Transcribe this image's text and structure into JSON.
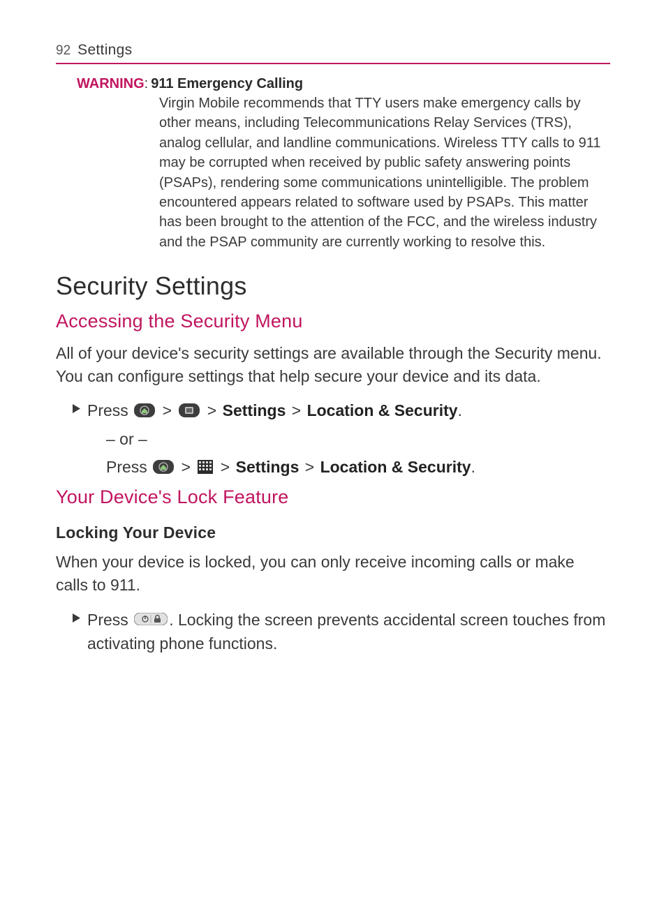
{
  "header": {
    "page_number": "92",
    "title": "Settings"
  },
  "warning": {
    "label": "WARNING",
    "colon": ": ",
    "subject": "911 Emergency Calling",
    "body": "Virgin Mobile recommends that TTY users make emergency calls by other means, including Telecommunications Relay Services (TRS), analog cellular, and landline communications. Wireless TTY calls to 911 may be corrupted when received by public safety answering points (PSAPs), rendering some communications unintelligible. The problem encountered appears related to software used by PSAPs. This matter has been brought to the attention of the FCC, and the wireless industry and the PSAP community are currently working to resolve this."
  },
  "section_heading": "Security Settings",
  "sub1": {
    "heading": "Accessing the Security Menu",
    "body": "All of your device's security settings are available through the Security menu. You can configure settings that help secure your device and its data.",
    "step": {
      "press": "Press ",
      "gt": " > ",
      "settings": "Settings",
      "location_security": "Location & Security",
      "period": ".",
      "or": "– or –"
    }
  },
  "sub2": {
    "heading": "Your Device's Lock Feature",
    "sub_heading": "Locking Your Device",
    "body": "When your device is locked, you can only receive incoming calls or make calls to 911.",
    "step": {
      "press": "Press ",
      "after": ". Locking the screen prevents accidental screen touches from activating phone functions."
    }
  },
  "icons": {
    "home": "home-key-icon",
    "menu": "menu-key-icon",
    "apps": "apps-grid-icon",
    "power": "power-lock-key-icon"
  }
}
